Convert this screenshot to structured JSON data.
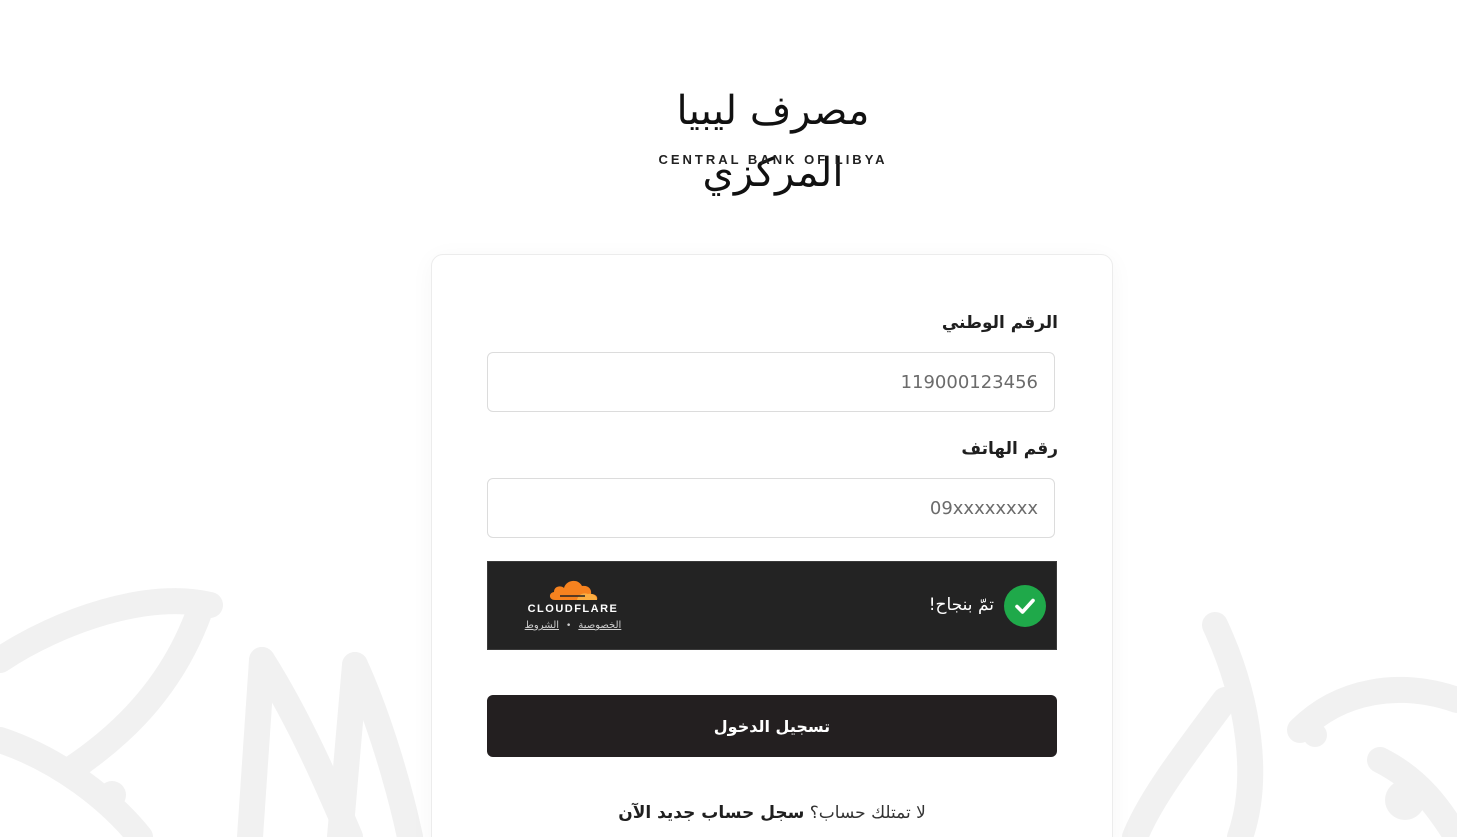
{
  "logo": {
    "arabic": "مصرف ليبيا المركزي",
    "latin": "CENTRAL BANK OF LIBYA"
  },
  "form": {
    "national_id": {
      "label": "الرقم الوطني",
      "placeholder": "119000123456",
      "value": ""
    },
    "phone": {
      "label": "رقم الهاتف",
      "placeholder": "09xxxxxxxx",
      "value": ""
    },
    "captcha": {
      "status": "تمّ بنجاح!",
      "brand": "CLOUDFLARE",
      "privacy_link": "الخصوصية",
      "terms_link": "الشروط",
      "separator": "•",
      "success_color": "#1fa94a",
      "brand_color": "#f6821f"
    },
    "submit_label": "تسجيل الدخول",
    "register": {
      "prompt": "لا تمتلك حساب؟",
      "link": "سجل حساب جديد الآن"
    }
  },
  "colors": {
    "button_bg": "#231f20",
    "widget_bg": "#232323"
  },
  "icons": {
    "check": "check-icon",
    "cloud": "cloud-icon"
  }
}
